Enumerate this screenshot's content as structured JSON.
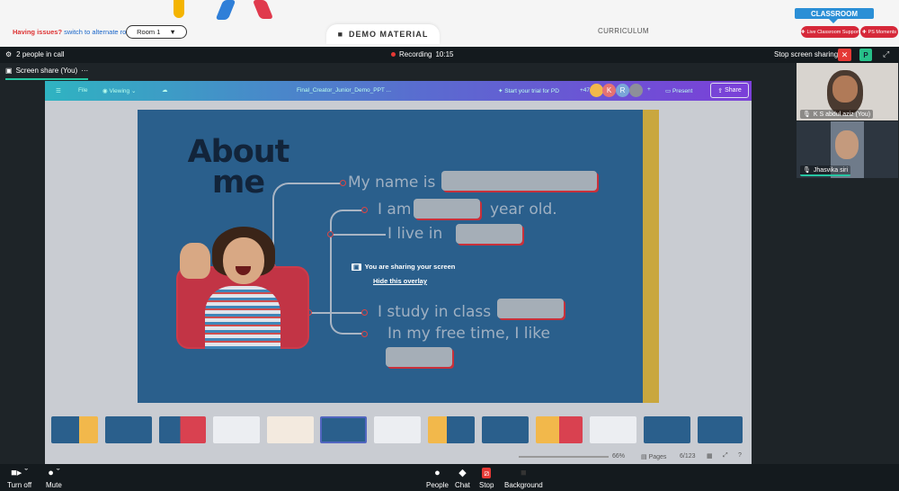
{
  "header": {
    "issues_text": "Having issues?",
    "alt_room_link": "switch to alternate room",
    "room_select": "Room 1",
    "demo_tab": "DEMO MATERIAL",
    "curriculum_tab": "CURRICULUM",
    "classroom_tab": "CLASSROOM",
    "live_support": "Live Classroom Support",
    "ps_moments": "PS Moments"
  },
  "call": {
    "people_count": "2 people in call",
    "recording_label": "Recording",
    "recording_time": "10:15",
    "stop_sharing": "Stop screen sharing",
    "close_symbol": "✕",
    "p_avatar": "P",
    "screen_share_tab": "Screen share (You)",
    "more_symbol": "···"
  },
  "canva": {
    "file": "File",
    "viewing": "Viewing",
    "doc_title": "Final_Creator_Junior_Demo_PPT ...",
    "trial": "Start your trial for PD",
    "count": "+47",
    "avatars": [
      "K",
      "R"
    ],
    "present": "Present",
    "share": "Share",
    "zoom": "66%",
    "pages": "Pages",
    "page_num": "6/123"
  },
  "slide": {
    "title_line1": "About",
    "title_line2": "me",
    "line_name": "My name is",
    "line_age_a": "I am",
    "line_age_b": "year old.",
    "line_live": "I live in",
    "line_class": "I study in class",
    "line_free": "In my free time, I like"
  },
  "overlay": {
    "sharing": "You are sharing your screen",
    "hide": "Hide this overlay"
  },
  "participants": [
    {
      "name": "K S abdul aziz (You)"
    },
    {
      "name": "Jhasvika siri"
    }
  ],
  "toolbar": {
    "turn_off": "Turn off",
    "mute": "Mute",
    "people": "People",
    "chat": "Chat",
    "stop": "Stop",
    "background": "Background"
  },
  "colors": {
    "accent_green": "#26c6a2",
    "record_red": "#e53935",
    "support_red": "#d62839",
    "classroom_blue": "#2b8fd6"
  }
}
